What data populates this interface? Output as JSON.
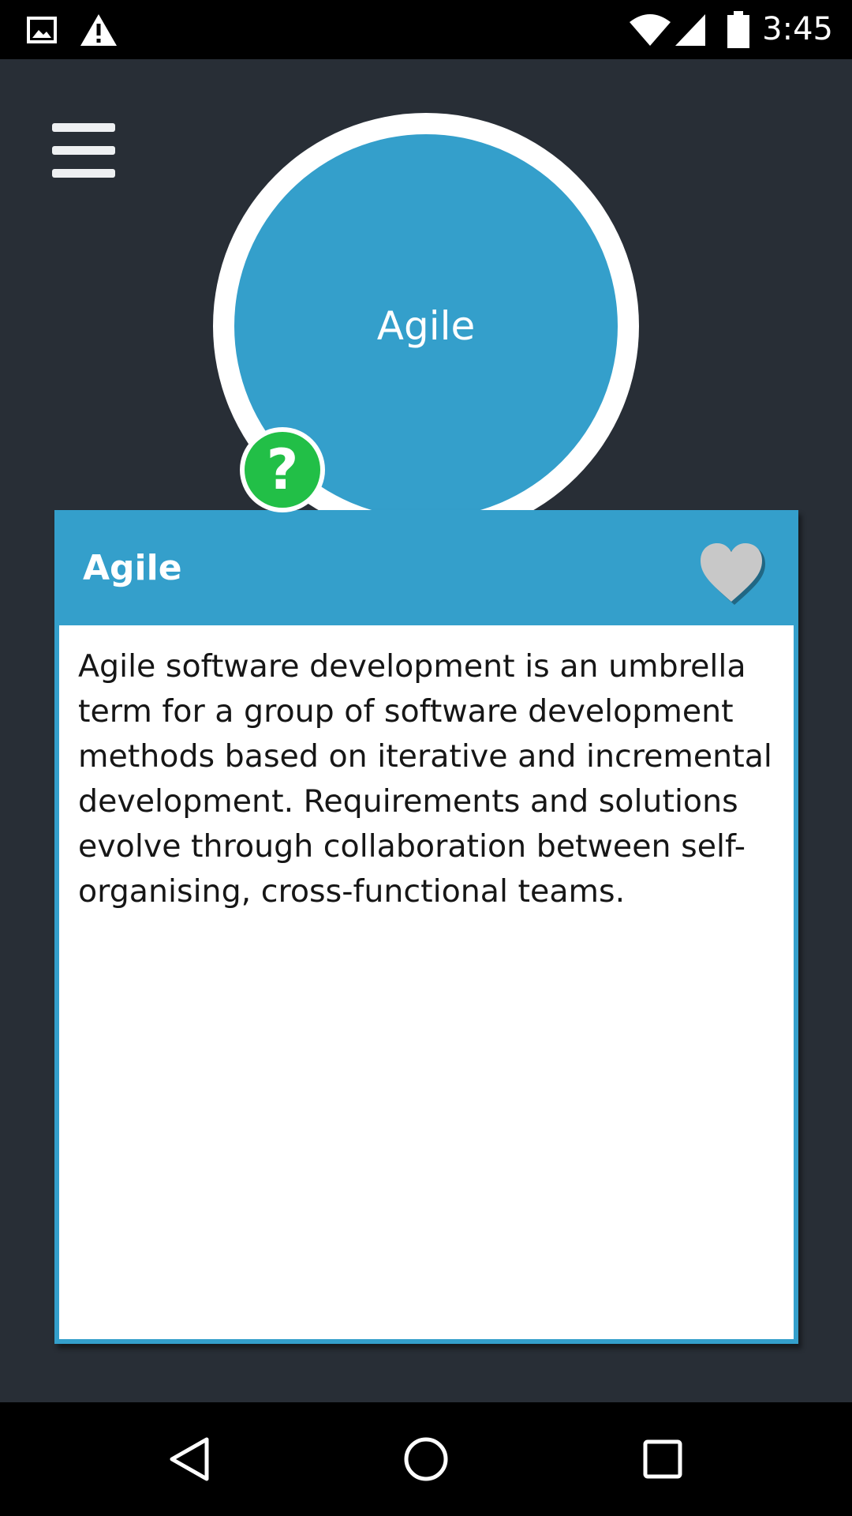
{
  "status_bar": {
    "time": "3:45",
    "left_icons": [
      "image-icon",
      "warning-icon"
    ],
    "right_icons": [
      "wifi-icon",
      "cellular-signal-icon",
      "battery-icon"
    ]
  },
  "topic": {
    "circle_label": "Agile",
    "help_symbol": "?"
  },
  "card": {
    "title": "Agile",
    "favorite_icon": "heart-icon",
    "description": "Agile software development is an umbrella term for a group of software development methods based on iterative and incremental development. Requirements and solutions evolve through collaboration between self-organising, cross-functional teams."
  },
  "nav_bar": {
    "buttons": [
      "back-icon",
      "home-icon",
      "recents-icon"
    ]
  },
  "colors": {
    "background": "#282e36",
    "accent_blue": "#349fcb",
    "help_green": "#22bf47",
    "heart_grey": "#c8c8c8",
    "system_bar": "#000000"
  }
}
